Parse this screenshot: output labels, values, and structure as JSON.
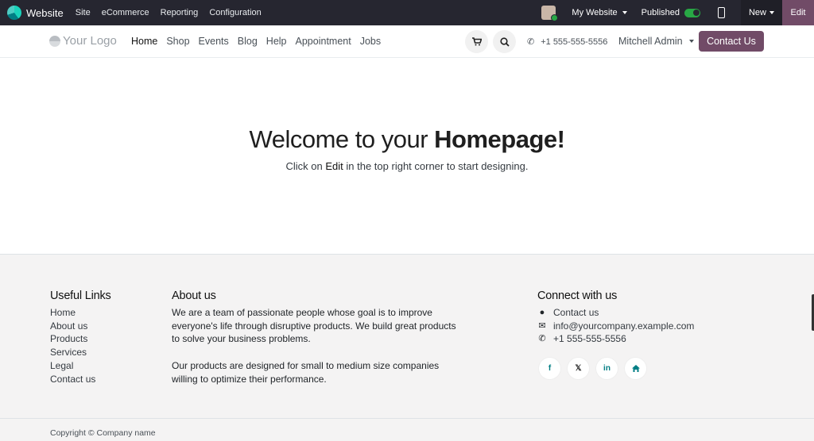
{
  "adminbar": {
    "app_name": "Website",
    "menu": [
      "Site",
      "eCommerce",
      "Reporting",
      "Configuration"
    ],
    "website_selector": "My Website",
    "published_label": "Published",
    "new_label": "New",
    "edit_label": "Edit",
    "accent_color": "#714b67"
  },
  "header": {
    "logo_text": "Your Logo",
    "nav": [
      "Home",
      "Shop",
      "Events",
      "Blog",
      "Help",
      "Appointment",
      "Jobs"
    ],
    "phone": "+1 555-555-5556",
    "user": "Mitchell Admin",
    "contact_button": "Contact Us"
  },
  "hero": {
    "title_prefix": "Welcome to your ",
    "title_bold": "Homepage!",
    "sub_before": "Click on ",
    "sub_edit": "Edit",
    "sub_after": " in the top right corner to start designing."
  },
  "footer": {
    "useful_links": {
      "title": "Useful Links",
      "items": [
        "Home",
        "About us",
        "Products",
        "Services",
        "Legal",
        "Contact us"
      ]
    },
    "about": {
      "title": "About us",
      "p1": "We are a team of passionate people whose goal is to improve everyone's life through disruptive products. We build great products to solve your business problems.",
      "p2": "Our products are designed for small to medium size companies willing to optimize their performance."
    },
    "connect": {
      "title": "Connect with us",
      "contact": "Contact us",
      "email": "info@yourcompany.example.com",
      "phone": "+1 555-555-5556",
      "socials": [
        "facebook-icon",
        "x-icon",
        "linkedin-icon",
        "home-icon"
      ]
    },
    "copyright": "Copyright © Company name"
  }
}
